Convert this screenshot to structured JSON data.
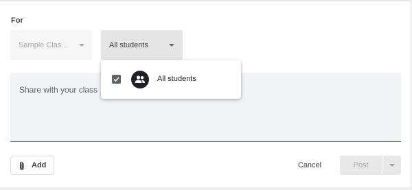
{
  "for_label": "For",
  "class_dropdown": {
    "value": "Sample Clas..."
  },
  "students_dropdown": {
    "value": "All students"
  },
  "students_menu": {
    "items": [
      {
        "label": "All students",
        "checked": true,
        "icon": "people-icon"
      }
    ]
  },
  "share": {
    "placeholder": "Share with your class"
  },
  "footer": {
    "add_label": "Add",
    "cancel_label": "Cancel",
    "post_label": "Post"
  },
  "icons": {
    "attach": "paperclip-icon",
    "dropdown": "caret-down-icon",
    "check": "check-icon",
    "people": "people-icon"
  },
  "colors": {
    "menu_bg": "#ffffff",
    "field_bg": "#f1f3f4",
    "disabled_text": "#a8a8a8"
  }
}
